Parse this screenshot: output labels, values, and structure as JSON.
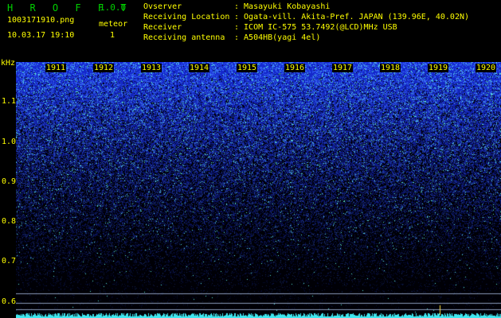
{
  "app": {
    "title": "H R O F F T",
    "version": "1.0.0"
  },
  "file": {
    "name": "1003171910.png",
    "date_time": "10.03.17 19:10"
  },
  "meteor": {
    "label": "meteor",
    "count": "1"
  },
  "info": [
    {
      "key": "Ovserver",
      "value": ": Masayuki Kobayashi"
    },
    {
      "key": "Receiving Location",
      "value": ": Ogata-vill. Akita-Pref. JAPAN (139.96E, 40.02N)"
    },
    {
      "key": "Receiver",
      "value": ": ICOM IC-575 53.7492(@LCD)MHz USB"
    },
    {
      "key": "Receiving antenna",
      "value": ": A504HB(yagi 4el)"
    }
  ],
  "axis": {
    "y_unit": "kHz",
    "y_ticks": [
      "1.1",
      "1.0",
      "0.9",
      "0.8",
      "0.7",
      "0.6"
    ],
    "x_ticks": [
      "1911",
      "1912",
      "1913",
      "1914",
      "1915",
      "1916",
      "1917",
      "1918",
      "1919",
      "1920"
    ]
  },
  "colors": {
    "label": "#ffff00",
    "title": "#00d000",
    "noise": "#2f4fd8",
    "signal": "#33e0c8",
    "baseline": "#40e8f0"
  }
}
